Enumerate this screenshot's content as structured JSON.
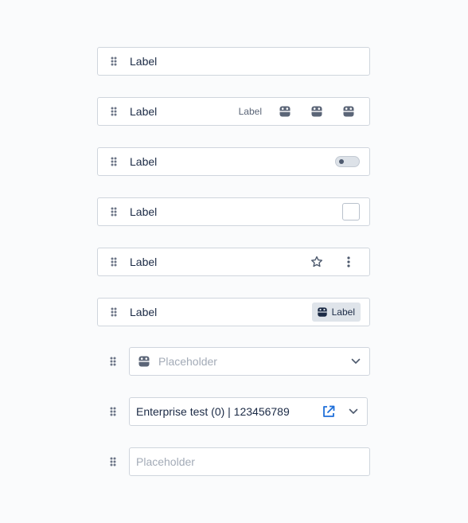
{
  "rows": [
    {
      "label": "Label"
    },
    {
      "label": "Label",
      "secondary_label": "Label"
    },
    {
      "label": "Label",
      "toggle_on": false
    },
    {
      "label": "Label",
      "checked": false
    },
    {
      "label": "Label"
    },
    {
      "label": "Label",
      "chip_label": "Label"
    }
  ],
  "select_field": {
    "placeholder": "Placeholder"
  },
  "enterprise_field": {
    "value": "Enterprise test (0) | 123456789"
  },
  "text_field": {
    "placeholder": "Placeholder"
  },
  "colors": {
    "accent": "#1f6fd9",
    "icon": "#5b6577",
    "handle": "#6b7486"
  }
}
